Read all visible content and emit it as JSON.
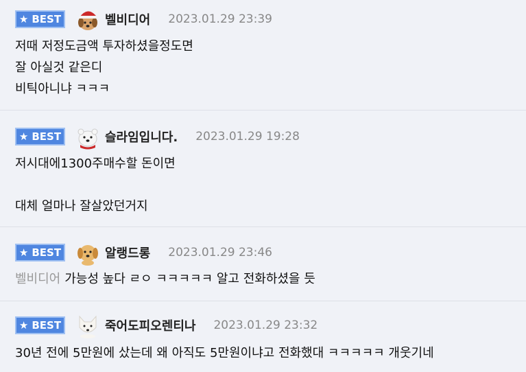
{
  "badge_label": "BEST",
  "comments": [
    {
      "nickname": "벨비디어",
      "date": "2023.01.29 23:39",
      "avatar": "puppy-with-santa-hat-icon",
      "lines": [
        "저때 저정도금액 투자하셨을정도면",
        "잘 아실것 같은디",
        "비틱아니냐 ㅋㅋㅋ"
      ]
    },
    {
      "nickname": "슬라임입니다.",
      "date": "2023.01.29 19:28",
      "avatar": "polar-bear-icon",
      "lines": [
        "저시대에1300주매수할 돈이면",
        "",
        "대체 얼마나 잘살았던거지"
      ]
    },
    {
      "nickname": "알랭드롱",
      "date": "2023.01.29 23:46",
      "avatar": "golden-puppy-icon",
      "reply_to": "벨비디어",
      "lines": [
        "가능성 높다 ㄹㅇ ㅋㅋㅋㅋㅋ 알고 전화하셨을 듯"
      ]
    },
    {
      "nickname": "죽어도피오렌티나",
      "date": "2023.01.29 23:32",
      "avatar": "white-fox-icon",
      "lines": [
        "30년 전에 5만원에 샀는데 왜 아직도 5만원이냐고 전화했대 ㅋㅋㅋㅋㅋ 개웃기네"
      ]
    }
  ],
  "colors": {
    "badge": "#4f86e0",
    "background": "#f0f2f7",
    "date": "#888888",
    "reply_name": "#999999"
  }
}
